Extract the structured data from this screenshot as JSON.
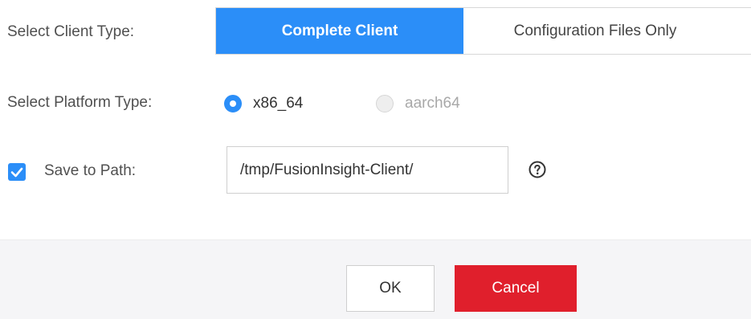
{
  "client_type": {
    "label": "Select Client Type:",
    "options": [
      {
        "label": "Complete Client",
        "selected": true
      },
      {
        "label": "Configuration Files Only",
        "selected": false
      }
    ]
  },
  "platform_type": {
    "label": "Select Platform Type:",
    "options": [
      {
        "label": "x86_64",
        "checked": true,
        "disabled": false
      },
      {
        "label": "aarch64",
        "checked": false,
        "disabled": true
      }
    ]
  },
  "save_path": {
    "checked": true,
    "label": "Save to Path:",
    "value": "/tmp/FusionInsight-Client/",
    "help_icon": "question-circle-icon"
  },
  "footer": {
    "ok_label": "OK",
    "cancel_label": "Cancel"
  },
  "colors": {
    "accent": "#2b8ef8",
    "danger": "#e01f2c",
    "footer_bg": "#f5f5f7"
  }
}
